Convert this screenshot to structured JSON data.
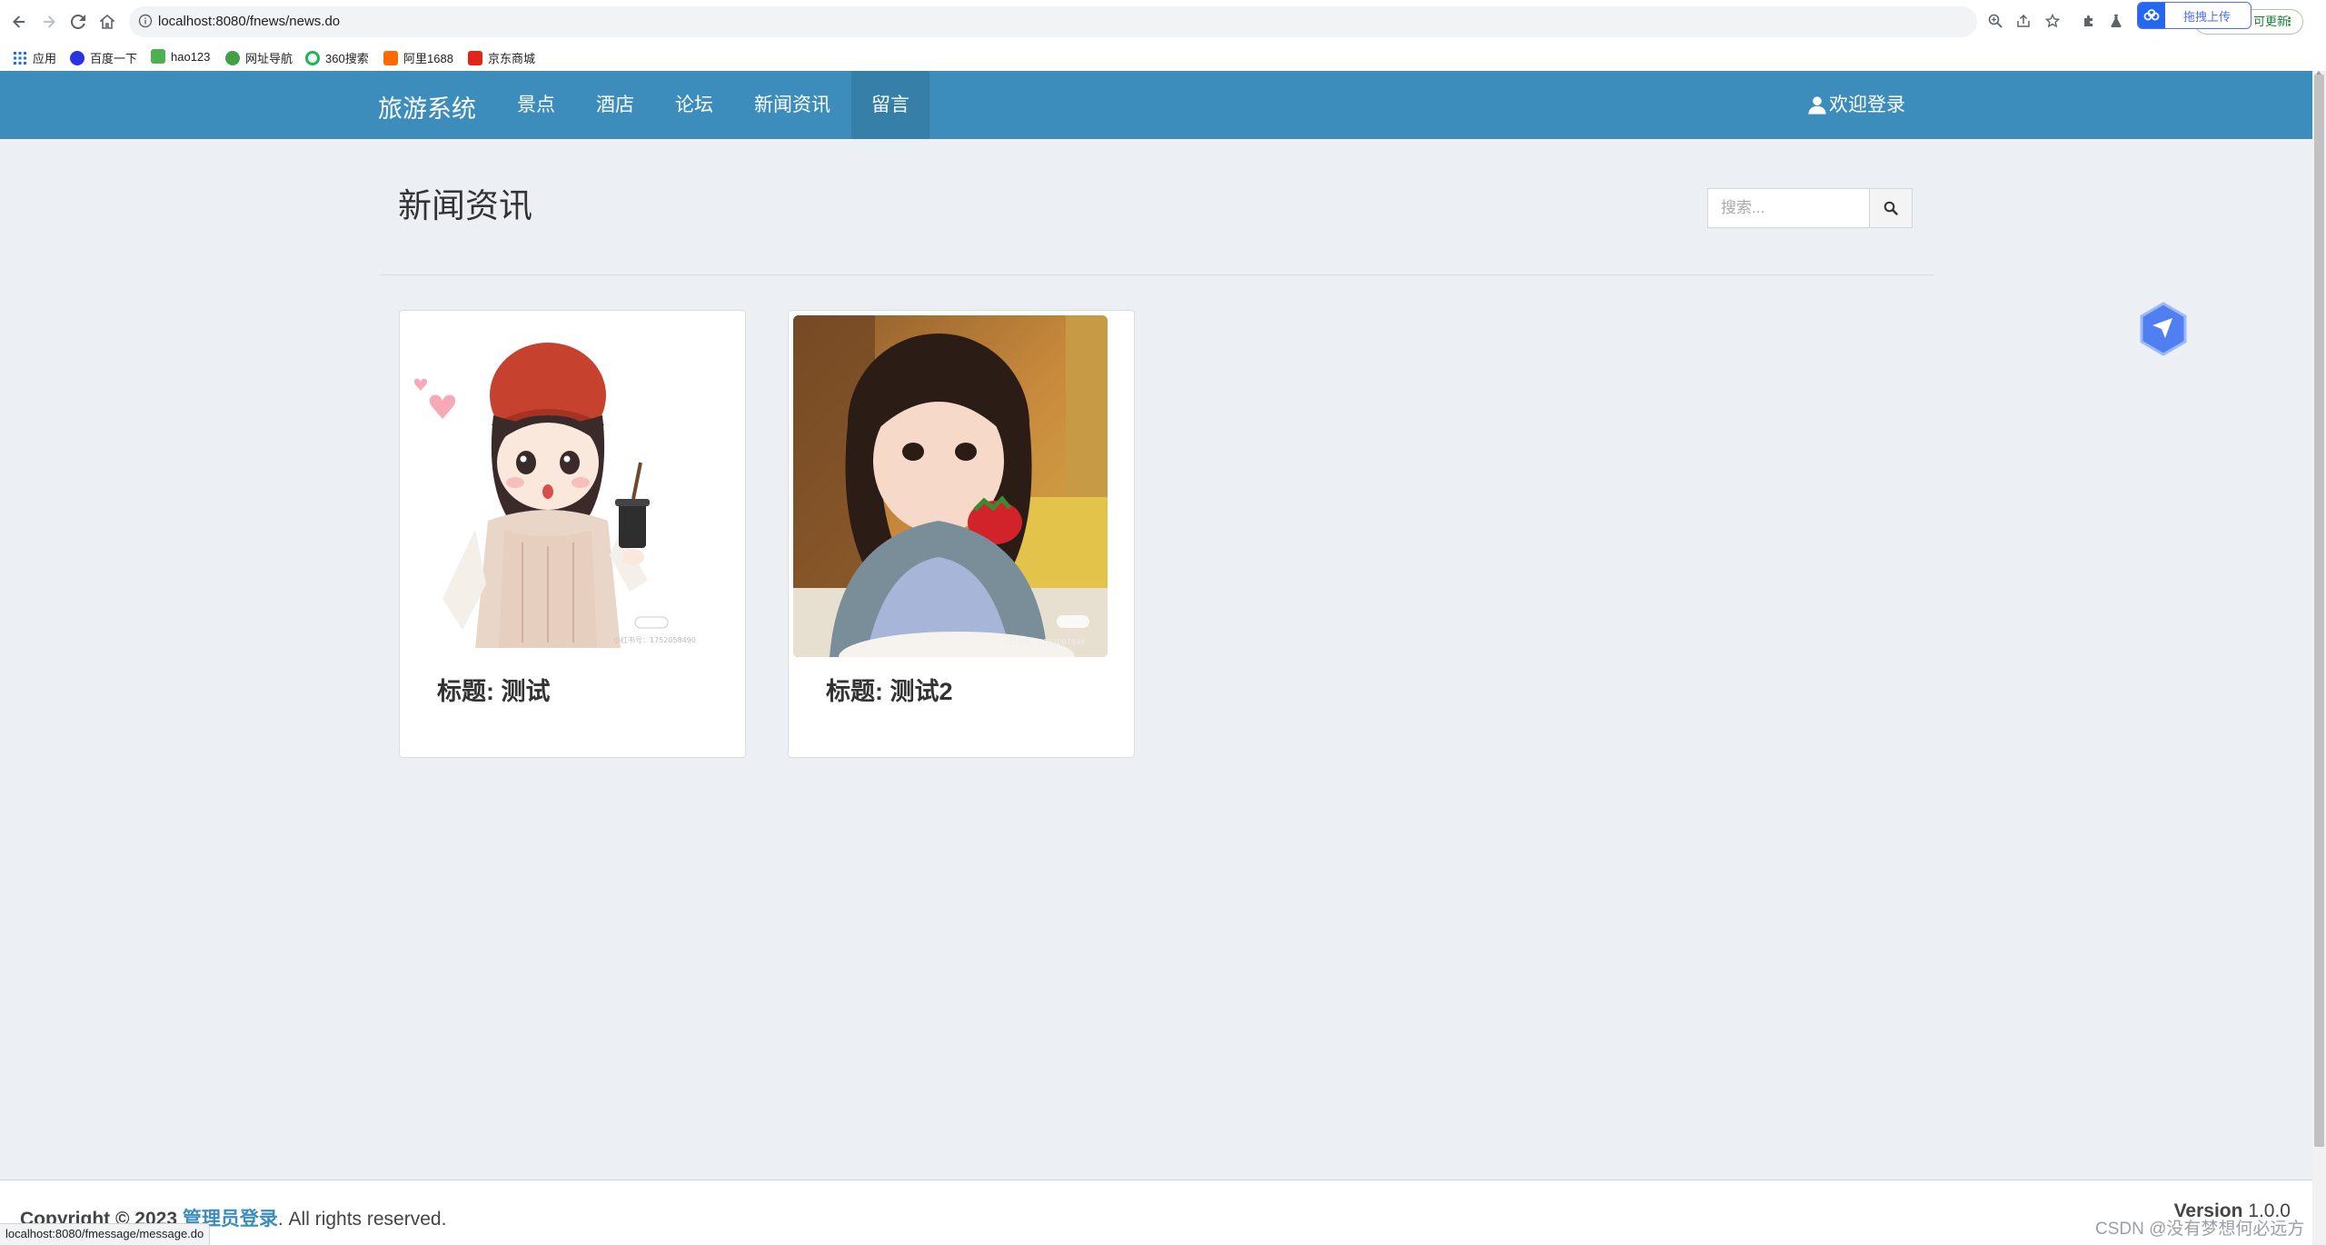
{
  "browser": {
    "url": "localhost:8080/fnews/news.do",
    "upload_label": "拖拽上传",
    "update_label": "可更新",
    "status_url": "localhost:8080/fmessage/message.do",
    "bookmarks": [
      {
        "label": "应用",
        "icon": "apps-grid-icon",
        "color": "#1a73e8"
      },
      {
        "label": "百度一下",
        "icon": "baidu-icon",
        "color": "#2932e1"
      },
      {
        "label": "hao123",
        "icon": "hao123-icon",
        "color": "#4caf50"
      },
      {
        "label": "网址导航",
        "icon": "navigation-icon",
        "color": "#43a047"
      },
      {
        "label": "360搜索",
        "icon": "so360-icon",
        "color": "#19b955"
      },
      {
        "label": "阿里1688",
        "icon": "ali1688-icon",
        "color": "#ff6a00"
      },
      {
        "label": "京东商城",
        "icon": "jd-icon",
        "color": "#e1251b"
      }
    ]
  },
  "navbar": {
    "brand": "旅游系统",
    "items": [
      {
        "label": "景点",
        "active": false
      },
      {
        "label": "酒店",
        "active": false
      },
      {
        "label": "论坛",
        "active": false
      },
      {
        "label": "新闻资讯",
        "active": false
      },
      {
        "label": "留言",
        "active": true
      }
    ],
    "login_label": "欢迎登录",
    "color": "#3c8dbc"
  },
  "page": {
    "title": "新闻资讯",
    "search_placeholder": "搜索..."
  },
  "news": [
    {
      "title": "标题: 测试",
      "image": "cartoon-girl-illustration"
    },
    {
      "title": "标题: 测试2",
      "image": "child-eating-strawberry-photo"
    }
  ],
  "footer": {
    "copyright_prefix": "Copyright © 2023",
    "admin_link": "管理员登录",
    "rights": ". All rights reserved.",
    "version_label": "Version",
    "version_value": "1.0.0"
  },
  "watermark": "CSDN @没有梦想何必远方"
}
